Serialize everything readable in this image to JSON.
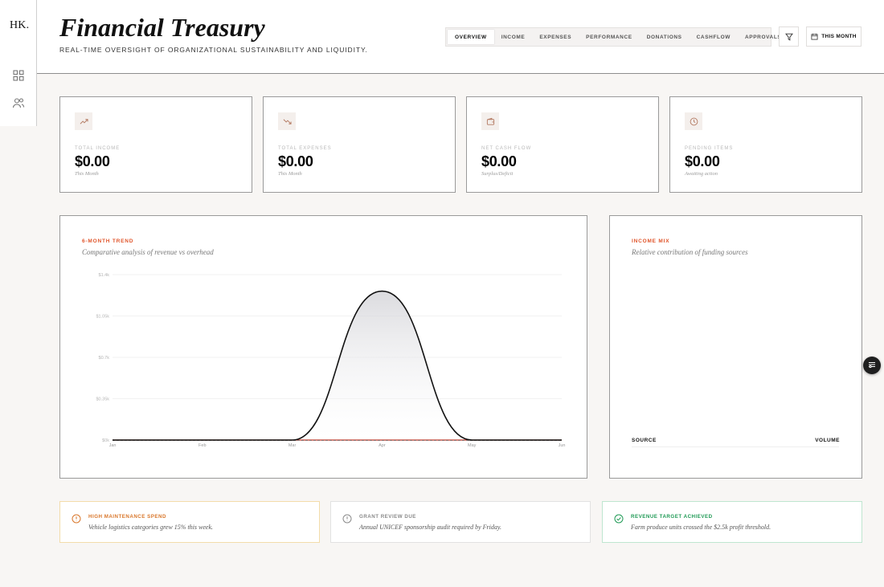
{
  "app": {
    "logo": "HK.",
    "title": "Financial Treasury",
    "subtitle": "REAL-TIME OVERSIGHT OF ORGANIZATIONAL SUSTAINABILITY AND LIQUIDITY."
  },
  "sidebar": {
    "items": [
      {
        "name": "dashboard",
        "icon": "grid-icon"
      },
      {
        "name": "users",
        "icon": "users-icon"
      }
    ]
  },
  "tabs": [
    {
      "label": "OVERVIEW",
      "active": true
    },
    {
      "label": "INCOME",
      "active": false
    },
    {
      "label": "EXPENSES",
      "active": false
    },
    {
      "label": "PERFORMANCE",
      "active": false
    },
    {
      "label": "DONATIONS",
      "active": false
    },
    {
      "label": "CASHFLOW",
      "active": false
    },
    {
      "label": "APPROVALS",
      "active": false
    }
  ],
  "toolbar": {
    "filter_icon": "filter-icon",
    "period_label": "THIS MONTH",
    "period_icon": "calendar-icon"
  },
  "stats": [
    {
      "label": "TOTAL INCOME",
      "value": "$0.00",
      "note": "This Month",
      "icon": "trending-up-icon"
    },
    {
      "label": "TOTAL EXPENSES",
      "value": "$0.00",
      "note": "This Month",
      "icon": "trending-down-icon"
    },
    {
      "label": "NET CASH FLOW",
      "value": "$0.00",
      "note": "Surplus/Deficit",
      "icon": "wallet-icon"
    },
    {
      "label": "PENDING ITEMS",
      "value": "$0.00",
      "note": "Awaiting action",
      "icon": "clock-icon"
    }
  ],
  "trend": {
    "kicker": "6-MONTH TREND",
    "subtitle": "Comparative analysis of revenue vs overhead"
  },
  "mix": {
    "kicker": "INCOME MIX",
    "subtitle": "Relative contribution of funding sources",
    "col_source": "SOURCE",
    "col_volume": "VOLUME"
  },
  "alerts": [
    {
      "title": "HIGH MAINTENANCE SPEND",
      "text": "Vehicle logistics categories grew 15% this week.",
      "color": "#d9772b",
      "border": "#f3dcaa",
      "icon": "alert-circle-icon"
    },
    {
      "title": "GRANT REVIEW DUE",
      "text": "Annual UNICEF sponsorship audit required by Friday.",
      "color": "#8a8a8a",
      "border": "#e2e2e2",
      "icon": "info-circle-icon"
    },
    {
      "title": "REVENUE TARGET ACHIEVED",
      "text": "Farm produce units crossed the $2.5k profit threshold.",
      "color": "#1f9a55",
      "border": "#bfe6d0",
      "icon": "check-circle-icon"
    }
  ],
  "chart_data": {
    "type": "area",
    "categories": [
      "Jan",
      "Feb",
      "Mar",
      "Apr",
      "May",
      "Jun"
    ],
    "y_ticks": [
      "$0k",
      "$0.35k",
      "$0.7k",
      "$1.05k",
      "$1.4k"
    ],
    "ylim": [
      0,
      1400
    ],
    "grid": true,
    "series": [
      {
        "values": [
          0,
          0,
          0,
          1260,
          0,
          0
        ],
        "color": "#111111",
        "smooth": true,
        "fill": true
      },
      {
        "values": [
          0,
          0,
          0,
          0,
          0,
          0
        ],
        "color": "#c0392b",
        "dashed": true
      }
    ]
  },
  "fab_icon": "sliders-icon"
}
